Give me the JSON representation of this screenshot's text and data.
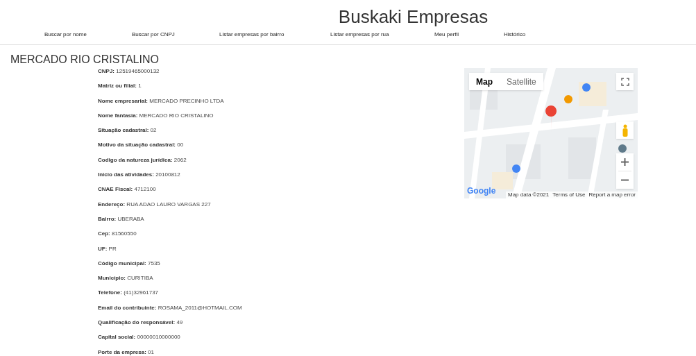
{
  "site_title": "Buskaki Empresas",
  "nav": [
    "Buscar por nome",
    "Buscar por CNPJ",
    "Listar empresas por bairro",
    "Listar empresas por rua",
    "Meu perfil",
    "Histórico"
  ],
  "company_title": "MERCADO RIO CRISTALINO",
  "fields": [
    {
      "label": "CNPJ:",
      "value": "12519465000132"
    },
    {
      "label": "Matriz ou filial:",
      "value": "1"
    },
    {
      "label": "Nome empresarial:",
      "value": "MERCADO PRECINHO LTDA"
    },
    {
      "label": "Nome fantasia:",
      "value": "MERCADO RIO CRISTALINO"
    },
    {
      "label": "Situação cadastral:",
      "value": "02"
    },
    {
      "label": "Motivo da situação cadastral:",
      "value": "00"
    },
    {
      "label": "Codigo da natureza jurídica:",
      "value": "2062"
    },
    {
      "label": "Inicio das atividades:",
      "value": "20100812"
    },
    {
      "label": "CNAE Fiscal:",
      "value": "4712100"
    },
    {
      "label": "Endereço:",
      "value": "RUA ADAO LAURO VARGAS 227"
    },
    {
      "label": "Bairro:",
      "value": "UBERABA"
    },
    {
      "label": "Cep:",
      "value": "81560550"
    },
    {
      "label": "UF:",
      "value": "PR"
    },
    {
      "label": "Código municipal:",
      "value": "7535"
    },
    {
      "label": "Município:",
      "value": "CURITIBA"
    },
    {
      "label": "Telefone:",
      "value": "(41)32961737"
    },
    {
      "label": "Email do contribuinte:",
      "value": "ROSAMA_2011@HOTMAIL.COM"
    },
    {
      "label": "Qualificação do responsável:",
      "value": "49"
    },
    {
      "label": "Capital social:",
      "value": "00000010000000"
    },
    {
      "label": "Porte da empresa:",
      "value": "01"
    }
  ],
  "map": {
    "map_types": [
      {
        "label": "Map",
        "selected": true
      },
      {
        "label": "Satellite",
        "selected": false
      }
    ],
    "logo": "Google",
    "footer": [
      "Map data ©2021",
      "Terms of Use",
      "Report a map error"
    ]
  }
}
